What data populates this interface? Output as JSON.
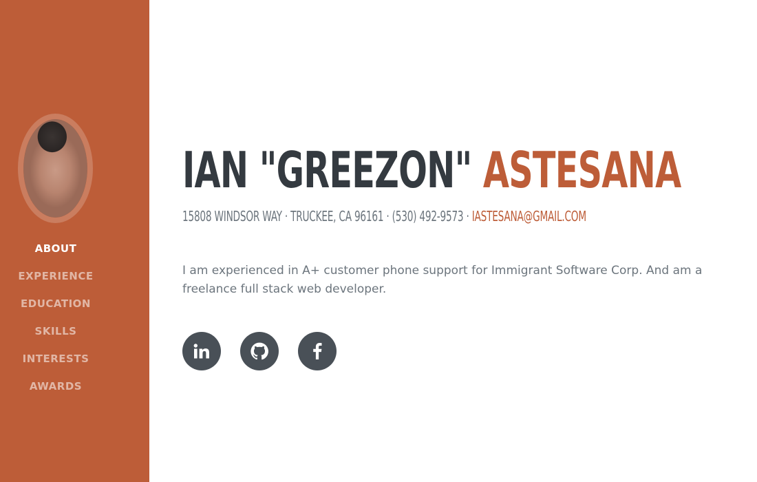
{
  "sidebar": {
    "background_color": "#bd5d38",
    "avatar_alt": "profile photo",
    "nav": [
      {
        "label": "ABOUT",
        "active": true
      },
      {
        "label": "EXPERIENCE",
        "active": false
      },
      {
        "label": "EDUCATION",
        "active": false
      },
      {
        "label": "SKILLS",
        "active": false
      },
      {
        "label": "INTERESTS",
        "active": false
      },
      {
        "label": "AWARDS",
        "active": false
      }
    ]
  },
  "header": {
    "first_name": "IAN \"GREEZON\"",
    "last_name": "ASTESANA",
    "address": "15808 WINDSOR WAY · TRUCKEE, CA 96161 · (530) 492-9573 ·",
    "email": "IASTESANA@GMAIL.COM"
  },
  "about": {
    "bio": "I am experienced in A+ customer phone support for Immigrant Software Corp. And am a freelance full stack web developer."
  },
  "social": [
    {
      "icon": "linkedin-icon"
    },
    {
      "icon": "github-icon"
    },
    {
      "icon": "facebook-icon"
    }
  ],
  "colors": {
    "accent": "#bd5d38",
    "heading": "#343a40",
    "muted": "#6c757d",
    "social_bg": "#495057"
  }
}
